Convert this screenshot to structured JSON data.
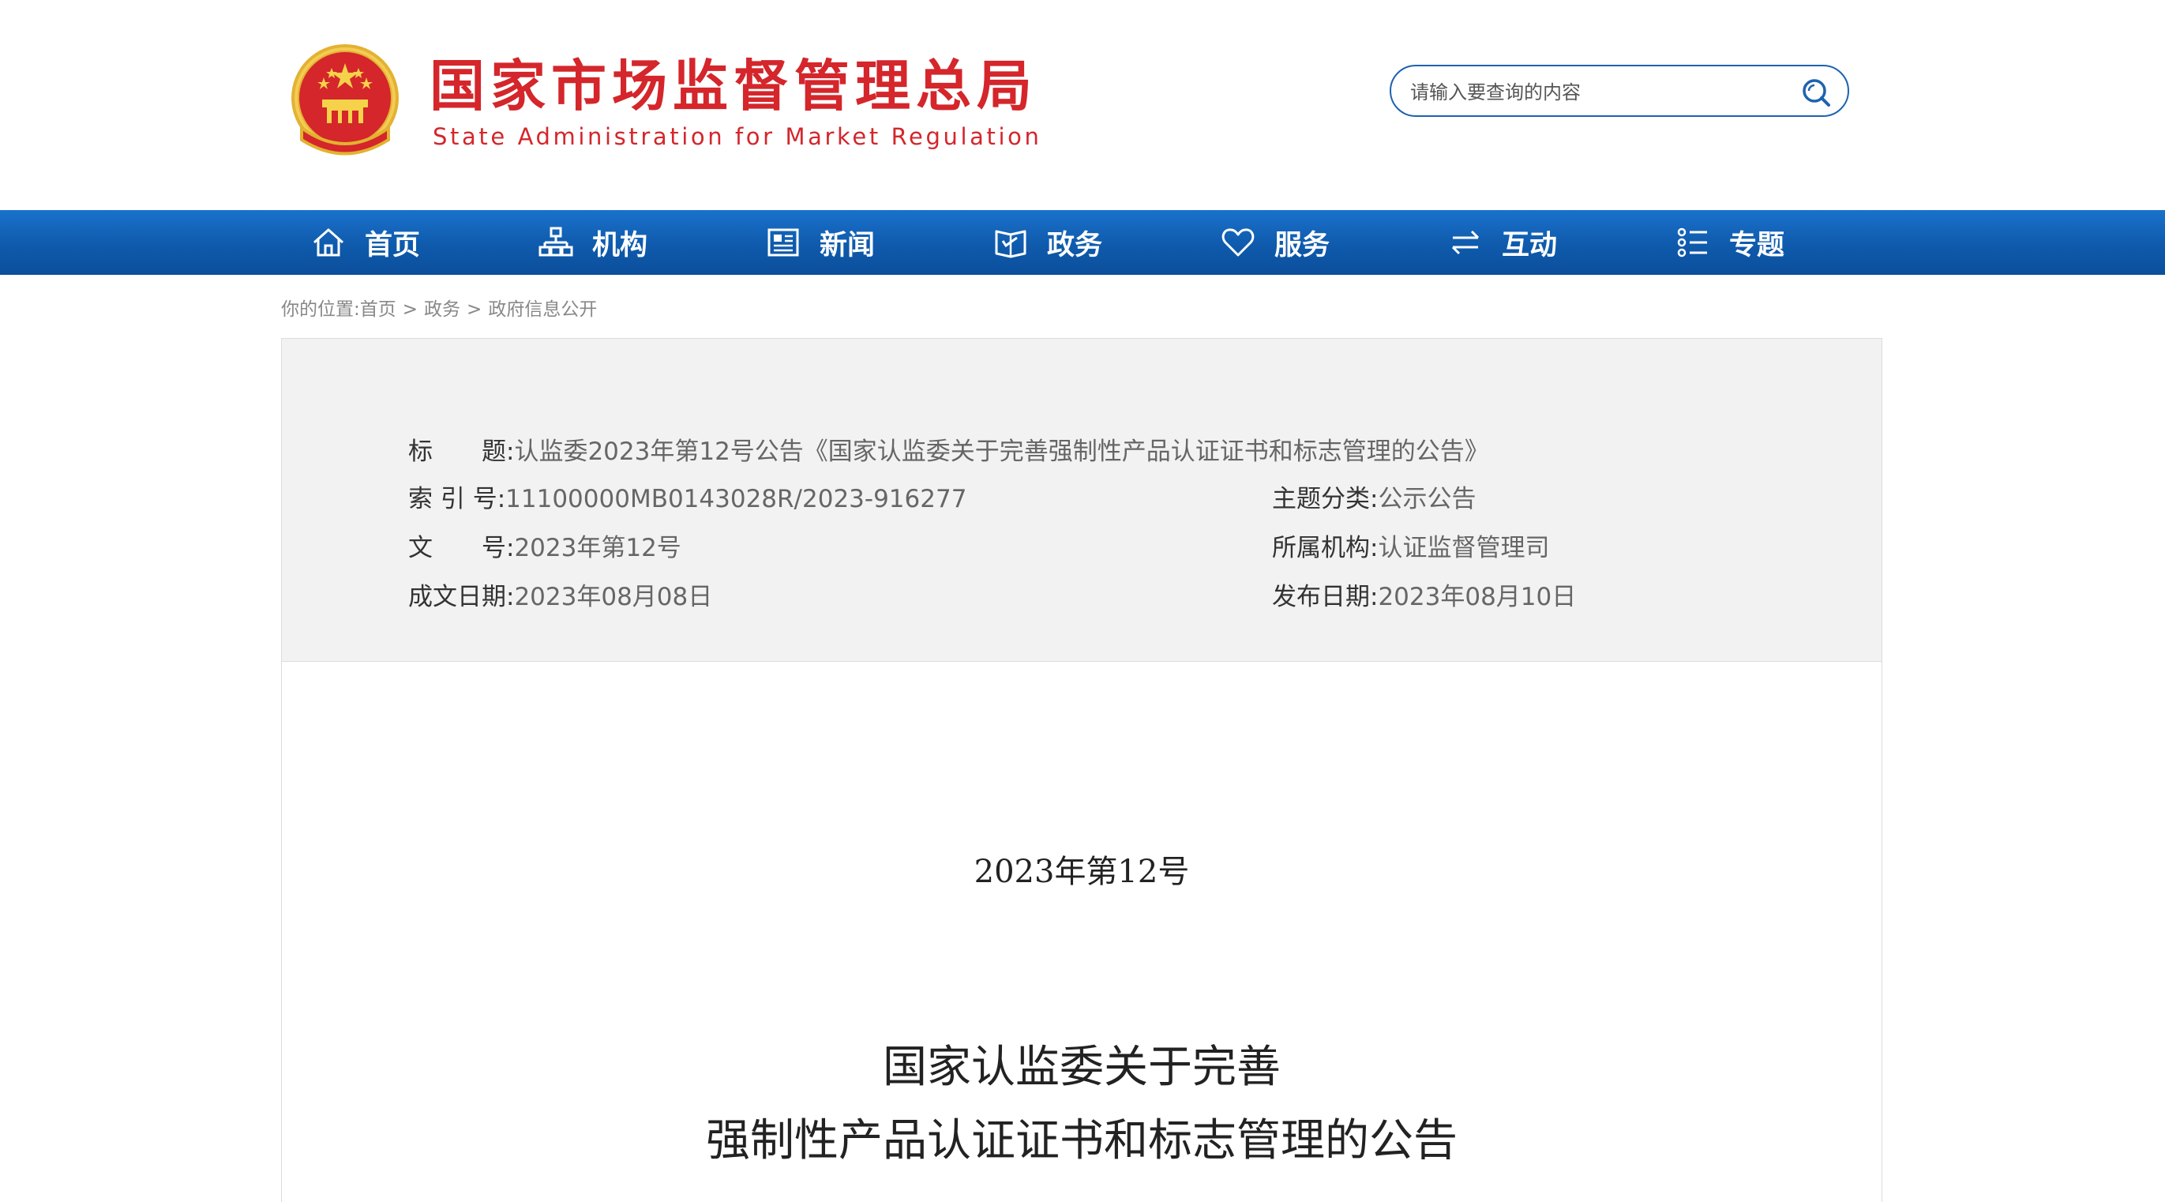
{
  "header": {
    "title": "国家市场监督管理总局",
    "subtitle": "State Administration for Market Regulation",
    "emblem_icon": "national-emblem",
    "search_placeholder": "请输入要查询的内容",
    "brand_red": "#d4262b",
    "accent_blue": "#1e62b0"
  },
  "nav": {
    "items": [
      {
        "label": "首页",
        "icon": "home-icon"
      },
      {
        "label": "机构",
        "icon": "org-chart-icon"
      },
      {
        "label": "新闻",
        "icon": "newspaper-icon"
      },
      {
        "label": "政务",
        "icon": "book-icon"
      },
      {
        "label": "服务",
        "icon": "heart-icon"
      },
      {
        "label": "互动",
        "icon": "swap-arrows-icon"
      },
      {
        "label": "专题",
        "icon": "list-icon"
      }
    ]
  },
  "breadcrumb": {
    "prefix": "你的位置:",
    "items": [
      "首页",
      "政务",
      "政府信息公开"
    ],
    "separator": ">"
  },
  "info": {
    "title_label": "标　　题:",
    "title_value": "认监委2023年第12号公告《国家认监委关于完善强制性产品认证证书和标志管理的公告》",
    "index_label": "索 引 号:",
    "index_value": "11100000MB0143028R/2023-916277",
    "topic_label": "主题分类:",
    "topic_value": "公示公告",
    "docno_label": "文　　号:",
    "docno_value": "2023年第12号",
    "org_label": "所属机构:",
    "org_value": "认证监督管理司",
    "created_label": "成文日期:",
    "created_value": "2023年08月08日",
    "published_label": "发布日期:",
    "published_value": "2023年08月10日"
  },
  "document": {
    "number": "2023年第12号",
    "title_line1": "国家认监委关于完善",
    "title_line2": "强制性产品认证证书和标志管理的公告"
  }
}
